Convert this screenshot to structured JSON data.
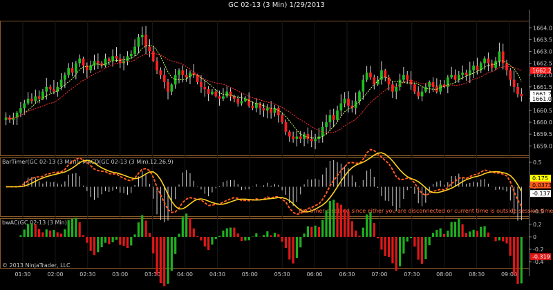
{
  "title": "GC 02-13 (3 Min)  1/29/2013",
  "colors": {
    "up": "#1fbf1f",
    "down": "#ff2020",
    "wick": "#dcdcdc",
    "grid": "#1a1a1a",
    "panel_border": "#8a5a2a",
    "sma_fast": "#c8ff60",
    "sma_slow": "#ff3030",
    "macd": "#ff5a1e",
    "signal": "#ffd21e",
    "hist": "#d8d8d8",
    "ac_up": "#20b020",
    "ac_down": "#e01818"
  },
  "chart_data": [
    {
      "type": "candlestick",
      "panel": "price",
      "ylim": [
        1658.6,
        1664.3
      ],
      "yticks": [
        "1664.0",
        "1663.5",
        "1663.0",
        "1662.5",
        "1662.0",
        "1661.5",
        "1661.0",
        "1660.5",
        "1660.0",
        "1659.5",
        "1659.0"
      ],
      "last_price_labels": [
        "1662.2",
        "1661.2",
        "1661.0"
      ],
      "x_ticks": [
        "01:30",
        "02:00",
        "02:30",
        "03:00",
        "03:30",
        "04:00",
        "04:30",
        "05:00",
        "05:30",
        "06:00",
        "06:30",
        "07:00",
        "07:30",
        "08:00",
        "08:30",
        "09:00"
      ],
      "path": [
        1660.2,
        1660.1,
        1660.2,
        1660.4,
        1660.6,
        1660.8,
        1661.0,
        1660.9,
        1661.1,
        1661.0,
        1661.3,
        1661.5,
        1661.4,
        1661.3,
        1661.5,
        1661.8,
        1662.0,
        1662.3,
        1662.1,
        1662.5,
        1662.7,
        1662.4,
        1662.2,
        1662.4,
        1662.6,
        1662.5,
        1662.4,
        1662.7,
        1662.6,
        1662.8,
        1662.7,
        1662.5,
        1662.6,
        1662.8,
        1662.9,
        1663.2,
        1663.6,
        1663.7,
        1663.2,
        1663.0,
        1662.6,
        1662.2,
        1662.0,
        1661.7,
        1661.3,
        1661.6,
        1662.0,
        1662.2,
        1662.0,
        1661.9,
        1662.1,
        1662.0,
        1661.7,
        1661.5,
        1661.4,
        1661.2,
        1661.3,
        1661.1,
        1661.0,
        1661.1,
        1661.3,
        1661.1,
        1661.0,
        1660.8,
        1660.9,
        1661.0,
        1660.7,
        1660.6,
        1660.8,
        1660.6,
        1660.5,
        1660.6,
        1660.4,
        1660.6,
        1660.3,
        1660.0,
        1659.6,
        1659.4,
        1659.3,
        1659.4,
        1659.3,
        1659.5,
        1659.3,
        1659.2,
        1659.3,
        1659.4,
        1659.8,
        1660.0,
        1660.3,
        1660.1,
        1660.5,
        1660.8,
        1661.0,
        1660.7,
        1660.6,
        1660.9,
        1661.3,
        1661.8,
        1662.1,
        1661.9,
        1661.6,
        1661.8,
        1662.2,
        1661.9,
        1661.6,
        1661.3,
        1661.5,
        1661.8,
        1662.0,
        1661.8,
        1661.6,
        1661.3,
        1661.1,
        1661.3,
        1661.5,
        1661.7,
        1661.5,
        1661.3,
        1661.6,
        1661.5,
        1661.9,
        1662.0,
        1661.8,
        1662.0,
        1662.1,
        1662.0,
        1662.2,
        1662.4,
        1662.2,
        1662.5,
        1662.7,
        1662.5,
        1662.3,
        1662.6,
        1663.0,
        1662.5,
        1662.2,
        1661.8,
        1661.5,
        1661.2,
        1661.1
      ]
    },
    {
      "type": "line",
      "panel": "macd",
      "title": "BarTimer(GC 02-13 (3 Min)); MACD(GC 02-13 (3 Min),12,26,9)",
      "yticks": [
        "0.5",
        "0",
        "-0.5"
      ],
      "ylim": [
        -0.6,
        0.6
      ],
      "value_labels": [
        "0.175",
        "0.0373",
        "-0.137"
      ],
      "notice": "Bar timer disabled since either you are disconnected or current time is outside session time or chart end date"
    },
    {
      "type": "bar",
      "panel": "bwac",
      "title": "bwAC(GC 02-13 (3 Min))",
      "yticks": [
        "0.2",
        "0",
        "-0.2",
        "-0.4"
      ],
      "ylim": [
        -0.5,
        0.3
      ],
      "value_label": "-0.319",
      "copyright": "© 2013 NinjaTrader, LLC"
    }
  ]
}
